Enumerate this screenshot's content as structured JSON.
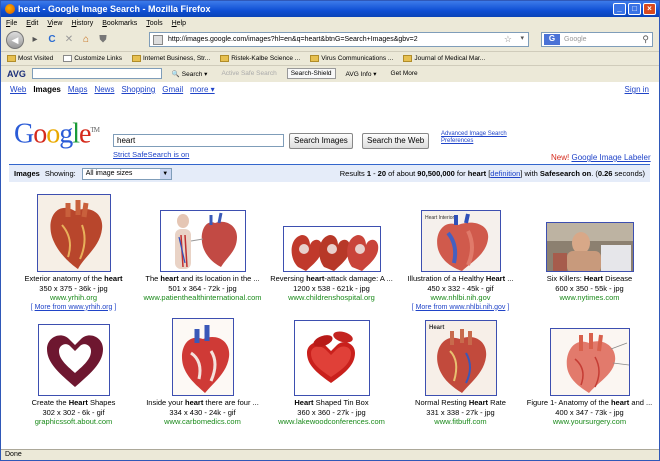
{
  "window": {
    "title": "heart - Google Image Search - Mozilla Firefox",
    "buttons": [
      "_",
      "□",
      "×"
    ]
  },
  "menu": [
    "File",
    "Edit",
    "View",
    "History",
    "Bookmarks",
    "Tools",
    "Help"
  ],
  "nav": {
    "url": "http://images.google.com/images?hl=en&q=heart&btnG=Search+Images&gbv=2",
    "search_placeholder": "Google",
    "search_logo": "G"
  },
  "bookmarks": [
    "Most Visited",
    "Customize Links",
    "Internet Business, Str...",
    "Ristek-Kalbe Science ...",
    "Virus Communications ...",
    "Journal of Medical Mar..."
  ],
  "avg": {
    "logo": "AVG",
    "search": "Search",
    "active_safe": "Active Safe Search",
    "shield": "Search-Shield",
    "info": "AVG Info",
    "more": "Get More"
  },
  "google": {
    "links": [
      "Web",
      "Images",
      "Maps",
      "News",
      "Shopping",
      "Gmail",
      "more ▾"
    ],
    "signin": "Sign in",
    "logo": [
      "G",
      "o",
      "o",
      "g",
      "l",
      "e"
    ],
    "tm": "TM",
    "query": "heart",
    "safe_link": "Strict SafeSearch is on",
    "btn_images": "Search Images",
    "btn_web": "Search the Web",
    "advanced": "Advanced Image Search",
    "prefs": "Preferences",
    "labeler_new": "New!",
    "labeler_link": "Google Image Labeler"
  },
  "results_bar": {
    "label": "Images",
    "showing": "Showing:",
    "size_option": "All image sizes",
    "p1": "Results ",
    "from": "1",
    "p2": " - ",
    "to": "20",
    "p3": " of about ",
    "count": "90,500,000",
    "p4": " for ",
    "query": "heart",
    "p5": " [",
    "definition": "definition",
    "p6": "] with ",
    "safe": "Safesearch on",
    "p7": ". (",
    "time": "0.26",
    "p8": " seconds)"
  },
  "results": [
    {
      "pre": "Exterior anatomy of the ",
      "b": "heart",
      "post": "",
      "dims": "350 x 375 - 36k - jpg",
      "url": "www.yrhih.org",
      "more": "More from www.yrhih.org"
    },
    {
      "pre": "The ",
      "b": "heart",
      "post": " and its location in the ...",
      "dims": "501 x 364 - 72k - jpg",
      "url": "www.patienthealthinternational.com",
      "more": ""
    },
    {
      "pre": "Reversing ",
      "b": "heart",
      "post": "-attack damage: A ...",
      "dims": "1200 x 538 - 621k - jpg",
      "url": "www.childrenshospital.org",
      "more": ""
    },
    {
      "pre": "Illustration of a Healthy ",
      "b": "Heart",
      "post": " ...",
      "dims": "450 x 332 - 45k - gif",
      "url": "www.nhlbi.nih.gov",
      "more": "More from www.nhlbi.nih.gov"
    },
    {
      "pre": "Six Killers: ",
      "b": "Heart",
      "post": " Disease",
      "dims": "600 x 350 - 55k - jpg",
      "url": "www.nytimes.com",
      "more": ""
    },
    {
      "pre": "Create the ",
      "b": "Heart",
      "post": " Shapes",
      "dims": "302 x 302 - 6k - gif",
      "url": "graphicssoft.about.com",
      "more": ""
    },
    {
      "pre": "Inside your ",
      "b": "heart",
      "post": " there are four ...",
      "dims": "334 x 430 - 24k - gif",
      "url": "www.carbomedics.com",
      "more": ""
    },
    {
      "pre": "",
      "b": "Heart",
      "post": " Shaped Tin Box",
      "dims": "360 x 360 - 27k - jpg",
      "url": "www.lakewoodconferences.com",
      "more": ""
    },
    {
      "pre": "Normal Resting ",
      "b": "Heart",
      "post": " Rate",
      "dims": "331 x 338 - 27k - jpg",
      "url": "www.fitbuff.com",
      "more": ""
    },
    {
      "pre": "Figure 1- Anatomy of the ",
      "b": "heart",
      "post": " and ...",
      "dims": "400 x 347 - 73k - jpg",
      "url": "www.yoursurgery.com",
      "more": ""
    }
  ],
  "thumb_labels": {
    "nhlbi": "Heart Interior",
    "fitbuff": "Heart"
  },
  "status": "Done"
}
